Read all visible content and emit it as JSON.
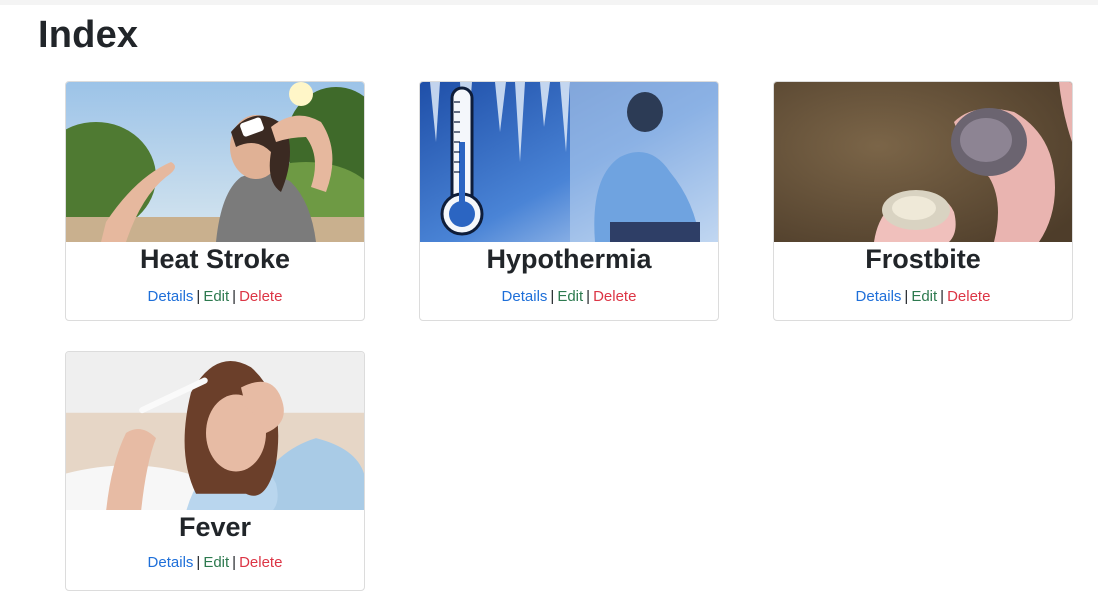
{
  "page": {
    "title": "Index"
  },
  "links": {
    "details": "Details",
    "edit": "Edit",
    "delete": "Delete",
    "separator": "|"
  },
  "cards": [
    {
      "name": "Heat Stroke"
    },
    {
      "name": "Hypothermia"
    },
    {
      "name": "Frostbite"
    },
    {
      "name": "Fever"
    }
  ],
  "colors": {
    "details": "#1e6fd9",
    "edit": "#2d7a4f",
    "delete": "#dc3545",
    "text": "#212529"
  }
}
